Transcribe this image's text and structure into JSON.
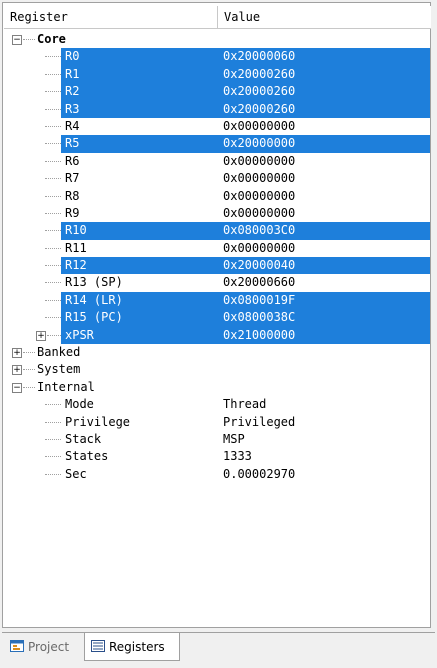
{
  "columns": {
    "register": "Register",
    "value": "Value"
  },
  "groups": {
    "core": "Core",
    "banked": "Banked",
    "system": "System",
    "internal": "Internal"
  },
  "core_registers": [
    {
      "name": "R0",
      "value": "0x20000060",
      "selected": true
    },
    {
      "name": "R1",
      "value": "0x20000260",
      "selected": true
    },
    {
      "name": "R2",
      "value": "0x20000260",
      "selected": true
    },
    {
      "name": "R3",
      "value": "0x20000260",
      "selected": true
    },
    {
      "name": "R4",
      "value": "0x00000000",
      "selected": false
    },
    {
      "name": "R5",
      "value": "0x20000000",
      "selected": true
    },
    {
      "name": "R6",
      "value": "0x00000000",
      "selected": false
    },
    {
      "name": "R7",
      "value": "0x00000000",
      "selected": false
    },
    {
      "name": "R8",
      "value": "0x00000000",
      "selected": false
    },
    {
      "name": "R9",
      "value": "0x00000000",
      "selected": false
    },
    {
      "name": "R10",
      "value": "0x080003C0",
      "selected": true
    },
    {
      "name": "R11",
      "value": "0x00000000",
      "selected": false
    },
    {
      "name": "R12",
      "value": "0x20000040",
      "selected": true
    },
    {
      "name": "R13 (SP)",
      "value": "0x20000660",
      "selected": false
    },
    {
      "name": "R14 (LR)",
      "value": "0x0800019F",
      "selected": true
    },
    {
      "name": "R15 (PC)",
      "value": "0x0800038C",
      "selected": true
    },
    {
      "name": "xPSR",
      "value": "0x21000000",
      "selected": true
    }
  ],
  "internal": [
    {
      "name": "Mode",
      "value": "Thread"
    },
    {
      "name": "Privilege",
      "value": "Privileged"
    },
    {
      "name": "Stack",
      "value": "MSP"
    },
    {
      "name": "States",
      "value": "1333"
    },
    {
      "name": "Sec",
      "value": "0.00002970"
    }
  ],
  "tabs": {
    "project": "Project",
    "registers": "Registers"
  },
  "colors": {
    "selection": "#1e7fdb",
    "tree_lines": "#a0a0a0"
  }
}
